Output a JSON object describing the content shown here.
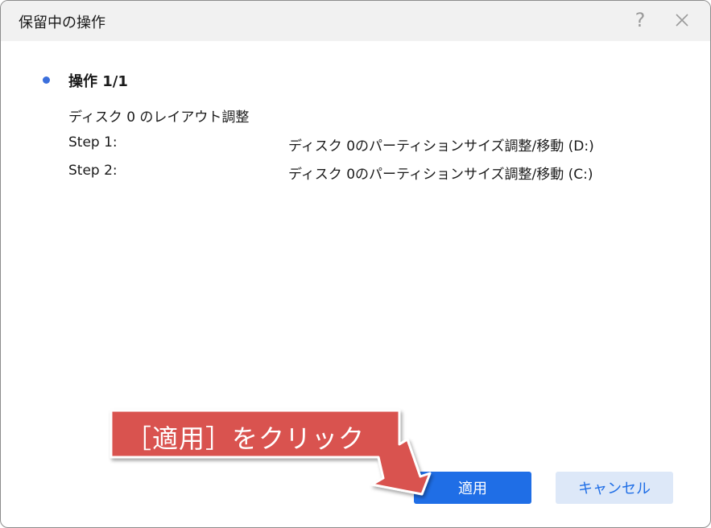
{
  "dialog": {
    "title": "保留中の操作",
    "help_glyph": "?"
  },
  "operation": {
    "heading": "操作 1/1",
    "description": "ディスク 0 のレイアウト調整",
    "steps": [
      {
        "label": "Step 1:",
        "value": "ディスク 0のパーティションサイズ調整/移動 (D:)"
      },
      {
        "label": "Step 2:",
        "value": "ディスク 0のパーティションサイズ調整/移動 (C:)"
      }
    ]
  },
  "buttons": {
    "apply_label": "適用",
    "cancel_label": "キャンセル"
  },
  "annotation": {
    "callout_text": "［適用］をクリック"
  },
  "colors": {
    "accent": "#1f6ee6",
    "cancel_bg": "#dde8f8",
    "callout": "#d9534f",
    "bullet": "#3b6fdc"
  }
}
